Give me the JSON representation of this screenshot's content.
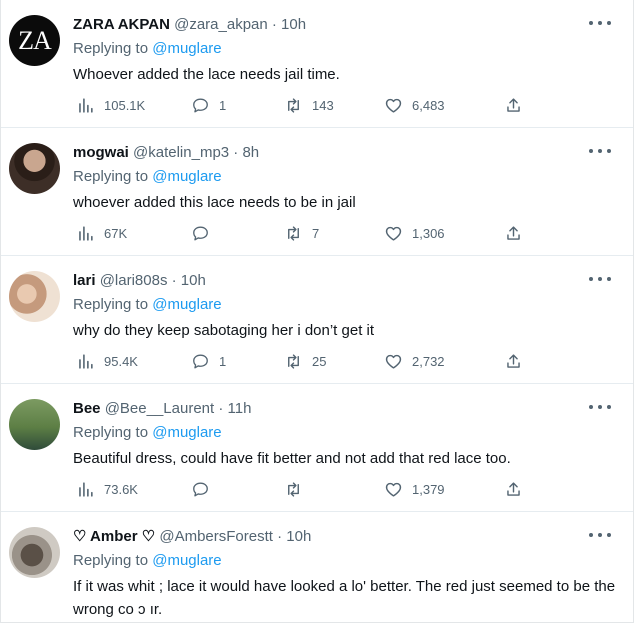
{
  "tweets": [
    {
      "name": "ZARA AKPAN",
      "handle": "@zara_akpan · 10h",
      "replying_prefix": "Replying to ",
      "replying_to": "@muglare",
      "text": "Whoever added the lace needs jail time.",
      "avatar_text": "ZA",
      "views": "105.1K",
      "replies": "1",
      "retweets": "143",
      "likes": "6,483"
    },
    {
      "name": "mogwai",
      "handle": "@katelin_mp3 · 8h",
      "replying_prefix": "Replying to ",
      "replying_to": "@muglare",
      "text": "whoever added this lace needs to be in jail",
      "views": "67K",
      "replies": "",
      "retweets": "7",
      "likes": "1,306"
    },
    {
      "name": "lari",
      "handle": "@lari808s · 10h",
      "replying_prefix": "Replying to ",
      "replying_to": "@muglare",
      "text": "why do they keep sabotaging her i don’t get it",
      "views": "95.4K",
      "replies": "1",
      "retweets": "25",
      "likes": "2,732"
    },
    {
      "name": "Bee",
      "handle": "@Bee__Laurent · 11h",
      "replying_prefix": "Replying to ",
      "replying_to": "@muglare",
      "text": "Beautiful dress, could have fit better and not add that red lace too.",
      "views": "73.6K",
      "replies": "",
      "retweets": "",
      "likes": "1,379"
    },
    {
      "name": "♡ Amber ♡",
      "handle": "@AmbersForestt · 10h",
      "replying_prefix": "Replying to ",
      "replying_to": "@muglare",
      "text": "If it was whit ; lace it would have looked a lo' better. The red just seemed to be the wrong co ɔ ır."
    }
  ]
}
